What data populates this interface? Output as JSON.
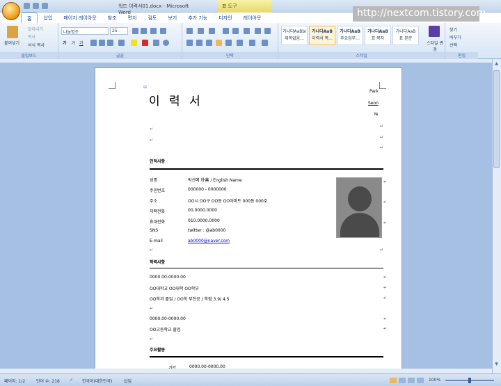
{
  "window": {
    "title": "워드 이력서01.docx - Microsoft Word",
    "context_tab": "표 도구",
    "watermark": "http://nextcom.tistory.com"
  },
  "tabs": [
    {
      "label": "홈",
      "active": true
    },
    {
      "label": "삽입"
    },
    {
      "label": "페이지 레이아웃"
    },
    {
      "label": "참조"
    },
    {
      "label": "편지"
    },
    {
      "label": "검토"
    },
    {
      "label": "보기"
    },
    {
      "label": "추가 기능"
    },
    {
      "label": "디자인"
    },
    {
      "label": "레이아웃"
    }
  ],
  "ribbon": {
    "clipboard": {
      "label": "클립보드",
      "paste": "붙여넣기",
      "cut": "잘라내기",
      "copy": "복사",
      "format_painter": "서식 복사"
    },
    "font": {
      "label": "글꼴",
      "font_name": "나눔명조",
      "font_size": "25",
      "bold": "가",
      "italic": "가",
      "underline": "가"
    },
    "paragraph": {
      "label": "단락"
    },
    "styles": {
      "label": "스타일",
      "items": [
        {
          "preview": "가나다AaBbI",
          "name": "제목없음..."
        },
        {
          "preview": "가나다AaB",
          "name": "이력서 목..."
        },
        {
          "preview": "가나다AaB",
          "name": "주요업무..."
        },
        {
          "preview": "가나다AaB",
          "name": "표 목차"
        },
        {
          "preview": "가나다AaB",
          "name": "표 본문"
        }
      ],
      "change_styles": "스타일 변경"
    },
    "editing": {
      "label": "편집",
      "find": "찾기",
      "replace": "바꾸기",
      "select": "선택"
    }
  },
  "document": {
    "title": "이 력 서",
    "name_lines": [
      "Park",
      "Seon",
      "Ye"
    ],
    "section_personal": "인적사항",
    "fields": [
      {
        "label": "성명",
        "value": "박선예 朴善 / English Name"
      },
      {
        "label": "주민번호",
        "value": "000000 - 0000000"
      },
      {
        "label": "주소",
        "value": "OO시 OO구 OO동 OO아파트 000동 000호"
      },
      {
        "label": "자택전화",
        "value": "00.0000.0000"
      },
      {
        "label": "휴대전화",
        "value": "010.0000.0000"
      },
      {
        "label": "SNS",
        "value": "twitter : @ab0000"
      },
      {
        "label": "E-mail",
        "value": "ab0000@naver.com"
      }
    ],
    "section_education": "학력사항",
    "education": [
      "0000.00-0000.00",
      "OO대학교 OO대학 OO학부",
      "OO학과 졸업 / OO학 부전공 / 학점 3.9/ 4.5",
      "0000.00-0000.00",
      "OO고등학교 졸업"
    ],
    "section_career": "주요활동",
    "career_first_label": "기간",
    "career_first_value": "0000.00-0000.00"
  },
  "status": {
    "page": "페이지: 1/2",
    "words": "단어 수: 218",
    "language": "한국어(대한민국)",
    "mode": "삽입",
    "zoom": "100%"
  }
}
